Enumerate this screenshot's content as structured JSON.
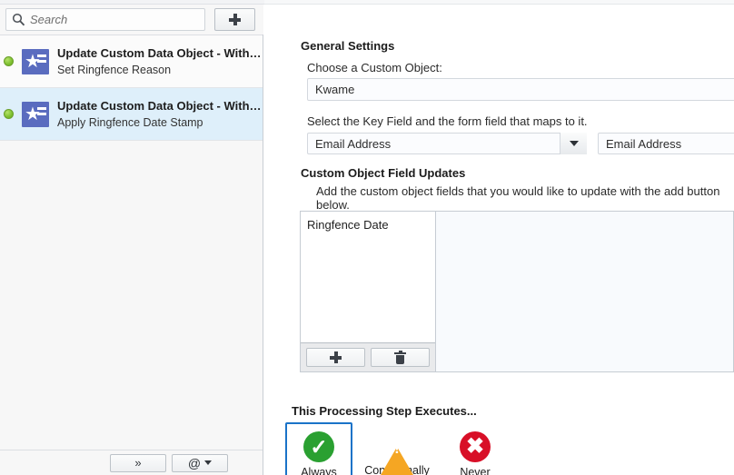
{
  "sidebar": {
    "search": {
      "placeholder": "Search",
      "value": "",
      "icon": "search-icon"
    },
    "add_button": {
      "icon": "plus-icon",
      "label": ""
    },
    "steps": [
      {
        "title": "Update Custom Data Object - With…",
        "subtitle": "Set Ringfence Reason",
        "status": "active",
        "icon": "custom-object-star-icon",
        "selected": false
      },
      {
        "title": "Update Custom Data Object - With…",
        "subtitle": "Apply Ringfence Date Stamp",
        "status": "active",
        "icon": "custom-object-star-icon",
        "selected": true
      }
    ],
    "footer": {
      "expand_button": {
        "glyph": "»",
        "icon": "double-chevron-right-icon"
      },
      "at_button": {
        "glyph": "@",
        "icon": "at-sign-icon",
        "caret": "▾"
      }
    }
  },
  "main": {
    "general_settings": {
      "heading": "General Settings",
      "object_label": "Choose a Custom Object:",
      "object_value": "Kwame",
      "key_field_label": "Select the Key Field and the form field that maps to it.",
      "key_field_value": "Email Address",
      "mapped_field_value": "Email Address"
    },
    "field_updates": {
      "heading": "Custom Object Field Updates",
      "description": "Add the custom object fields that you would like to update with the add button below.",
      "items": [
        "Ringfence Date"
      ],
      "add_button": {
        "icon": "plus-icon"
      },
      "delete_button": {
        "icon": "trash-icon"
      }
    },
    "execution": {
      "heading": "This Processing Step Executes...",
      "options": [
        {
          "label": "Always",
          "icon": "green-check-circle-icon",
          "selected": true
        },
        {
          "label": "Conditionally",
          "icon": "orange-warning-triangle-icon",
          "selected": false
        },
        {
          "label": "Never",
          "icon": "red-x-circle-icon",
          "selected": false
        }
      ]
    }
  },
  "colors": {
    "selected_row": "#deeffa",
    "accent_blue": "#1a73c8",
    "status_green": "#7dbf2f",
    "check_green": "#2aa031",
    "warn_orange": "#f5a623",
    "never_red": "#d80f27",
    "icon_blue": "#5a6cbf"
  }
}
